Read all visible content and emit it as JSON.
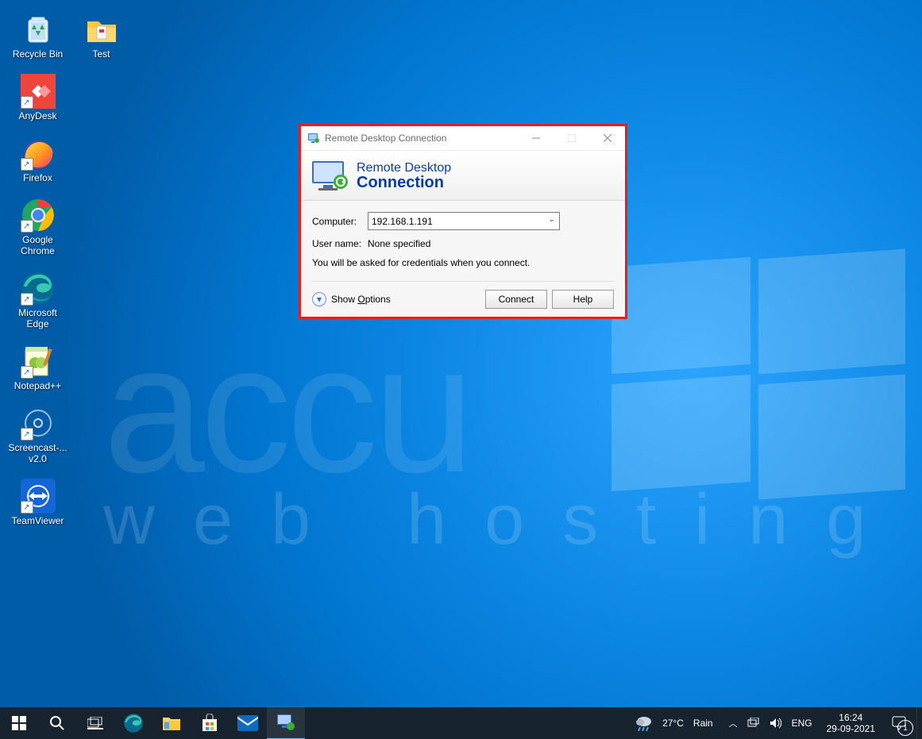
{
  "desktop": {
    "icons": [
      {
        "label": "Recycle Bin"
      },
      {
        "label": "AnyDesk"
      },
      {
        "label": "Firefox"
      },
      {
        "label": "Google Chrome"
      },
      {
        "label": "Microsoft Edge"
      },
      {
        "label": "Notepad++"
      },
      {
        "label": "Screencast-... v2.0"
      },
      {
        "label": "TeamViewer"
      }
    ],
    "col2": {
      "label": "Test"
    }
  },
  "dialog": {
    "title": "Remote Desktop Connection",
    "banner_line1": "Remote Desktop",
    "banner_line2": "Connection",
    "computer_label": "Computer:",
    "computer_value": "192.168.1.191",
    "username_label": "User name:",
    "username_value": "None specified",
    "hint": "You will be asked for credentials when you connect.",
    "show_options": "Show Options",
    "connect": "Connect",
    "help": "Help"
  },
  "taskbar": {
    "weather_temp": "27°C",
    "weather_cond": "Rain",
    "lang": "ENG",
    "time": "16:24",
    "date": "29-09-2021",
    "notif_count": "1"
  },
  "watermark": {
    "top": "accu",
    "bottom": "web hosting"
  }
}
